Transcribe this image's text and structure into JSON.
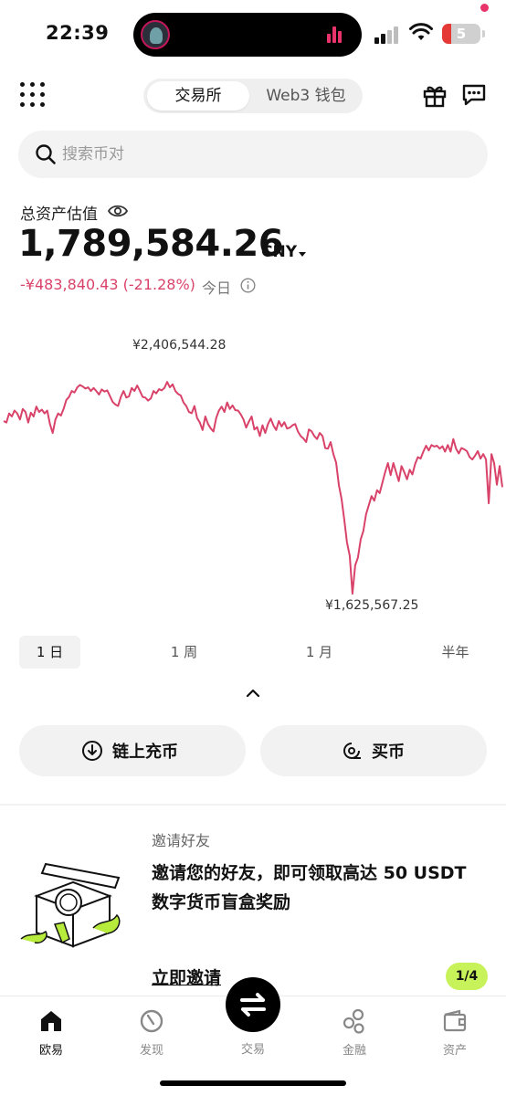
{
  "status_bar": {
    "time": "22:39",
    "battery_level": "5"
  },
  "header": {
    "tabs": [
      {
        "label": "交易所",
        "active": true
      },
      {
        "label": "Web3 钱包",
        "active": false
      }
    ],
    "icons": [
      "grid-icon",
      "gift-icon",
      "message-icon"
    ]
  },
  "search": {
    "placeholder": "搜索币对"
  },
  "assets": {
    "label": "总资产估值",
    "value": "1,789,584.26",
    "currency": "CNY",
    "change": "-¥483,840.43 (-21.28%)",
    "change_period": "今日",
    "colors": {
      "negative": "#d9436a"
    }
  },
  "chart_data": {
    "type": "line",
    "max_label": "¥2,406,544.28",
    "min_label": "¥1,625,567.25",
    "ylim": [
      1625567.25,
      2406544.28
    ],
    "color": "#d9436a",
    "values": [
      2200000,
      2195000,
      2225000,
      2215000,
      2235000,
      2225000,
      2205000,
      2240000,
      2230000,
      2195000,
      2228000,
      2215000,
      2248000,
      2230000,
      2238000,
      2225000,
      2235000,
      2190000,
      2160000,
      2205000,
      2225000,
      2218000,
      2240000,
      2270000,
      2280000,
      2300000,
      2295000,
      2312000,
      2320000,
      2315000,
      2308000,
      2312000,
      2300000,
      2310000,
      2300000,
      2288000,
      2305000,
      2298000,
      2302000,
      2283000,
      2264000,
      2255000,
      2250000,
      2280000,
      2300000,
      2278000,
      2282000,
      2310000,
      2300000,
      2318000,
      2300000,
      2280000,
      2278000,
      2268000,
      2275000,
      2300000,
      2292000,
      2306000,
      2302000,
      2310000,
      2330000,
      2312000,
      2322000,
      2300000,
      2290000,
      2285000,
      2262000,
      2250000,
      2230000,
      2226000,
      2250000,
      2210000,
      2195000,
      2170000,
      2215000,
      2190000,
      2175000,
      2165000,
      2210000,
      2235000,
      2248000,
      2230000,
      2262000,
      2240000,
      2252000,
      2236000,
      2235000,
      2222000,
      2205000,
      2178000,
      2198000,
      2215000,
      2172000,
      2180000,
      2150000,
      2186000,
      2160000,
      2190000,
      2208000,
      2185000,
      2170000,
      2200000,
      2182000,
      2196000,
      2175000,
      2178000,
      2186000,
      2190000,
      2165000,
      2150000,
      2142000,
      2130000,
      2172000,
      2166000,
      2150000,
      2140000,
      2160000,
      2150000,
      2110000,
      2108000,
      2130000,
      2090000,
      2062000,
      1987000,
      1940000,
      1870000,
      1796000,
      1752000,
      1625567,
      1720000,
      1746000,
      1806000,
      1834000,
      1890000,
      1920000,
      1950000,
      1935000,
      1970000,
      1960000,
      1995000,
      2030000,
      2060000,
      2020000,
      2060000,
      2030000,
      2000000,
      2050000,
      2030000,
      2006000,
      2038000,
      2022000,
      2057000,
      2080000,
      2075000,
      2098000,
      2118000,
      2102000,
      2120000,
      2115000,
      2118000,
      2108000,
      2116000,
      2098000,
      2120000,
      2098000,
      2140000,
      2108000,
      2092000,
      2110000,
      2106000,
      2100000,
      2080000,
      2072000,
      2085000,
      2100000,
      2075000,
      2090000,
      2072000,
      1926000,
      2090000,
      2060000,
      1988000,
      2050000,
      1980000
    ]
  },
  "periods": [
    {
      "label": "1 日",
      "active": true
    },
    {
      "label": "1 周",
      "active": false
    },
    {
      "label": "1 月",
      "active": false
    },
    {
      "label": "半年",
      "active": false
    }
  ],
  "actions": {
    "deposit": "链上充币",
    "buy": "买币"
  },
  "invite": {
    "title": "邀请好友",
    "text": "邀请您的好友，即可领取高达 50 USDT 数字货币盲盒奖励",
    "link": "立即邀请",
    "pager": "1/4",
    "accent_color": "#c8f25a"
  },
  "bottom_nav": [
    {
      "label": "欧易",
      "icon": "home-icon",
      "active": true
    },
    {
      "label": "发现",
      "icon": "discover-icon",
      "active": false
    },
    {
      "label": "交易",
      "icon": "trade-icon",
      "active": false
    },
    {
      "label": "金融",
      "icon": "finance-icon",
      "active": false
    },
    {
      "label": "资产",
      "icon": "wallet-icon",
      "active": false
    }
  ]
}
